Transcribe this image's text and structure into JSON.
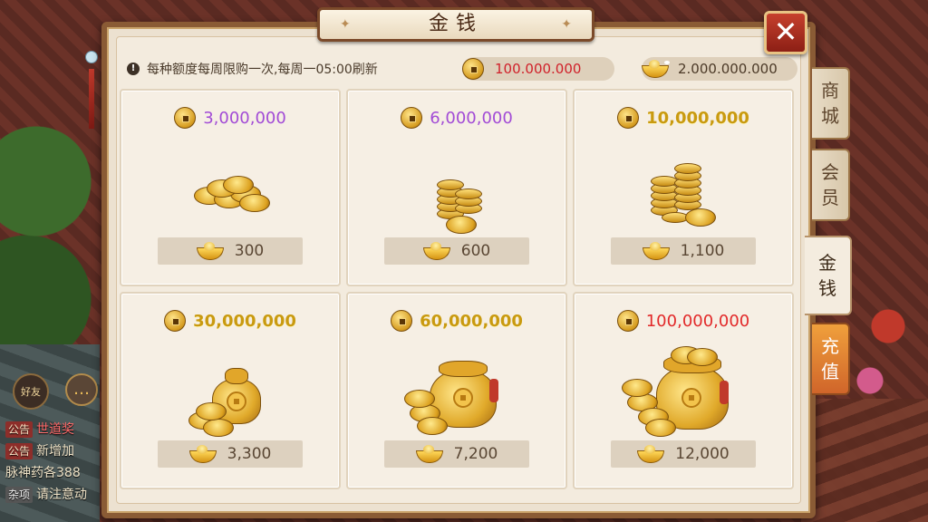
{
  "panel": {
    "title": "金钱",
    "notice": "每种额度每周限购一次,每周一05:00刷新",
    "coin_balance": "100.000.000",
    "ingot_balance": "2.000.000.000"
  },
  "packages": [
    {
      "amount": "3,000,000",
      "amount_color": "purple",
      "price": "300",
      "art": "coins-small"
    },
    {
      "amount": "6,000,000",
      "amount_color": "purple",
      "price": "600",
      "art": "coins-stack"
    },
    {
      "amount": "10,000,000",
      "amount_color": "gold",
      "price": "1,100",
      "art": "coins-stacks"
    },
    {
      "amount": "30,000,000",
      "amount_color": "gold",
      "price": "3,300",
      "art": "bag-small"
    },
    {
      "amount": "60,000,000",
      "amount_color": "gold",
      "price": "7,200",
      "art": "bag-medium"
    },
    {
      "amount": "100,000,000",
      "amount_color": "red",
      "price": "12,000",
      "art": "bag-large"
    }
  ],
  "tabs": [
    {
      "label": "商城",
      "line1": "商",
      "line2": "城",
      "active": false
    },
    {
      "label": "会员",
      "line1": "会",
      "line2": "员",
      "active": false
    },
    {
      "label": "金钱",
      "line1": "金",
      "line2": "钱",
      "active": true
    },
    {
      "label": "充值",
      "line1": "充",
      "line2": "值",
      "active": false
    }
  ],
  "chat": {
    "player_label": "好友",
    "lines": [
      {
        "tag": "公告",
        "text": "世道奖"
      },
      {
        "tag": "公告",
        "text": "新增加"
      },
      {
        "tag": "",
        "text": "脉神药各388"
      },
      {
        "tag": "杂项",
        "text": "请注意动"
      }
    ]
  },
  "colors": {
    "purple": "#a24bd6",
    "gold": "#c99a10",
    "red": "#e22a2a",
    "panel_border": "#8a5b35",
    "close": "#b8321f"
  },
  "icons": {
    "coin": "copper-coin-icon",
    "ingot": "gold-ingot-icon",
    "close": "close-icon",
    "notice": "exclamation-icon"
  }
}
